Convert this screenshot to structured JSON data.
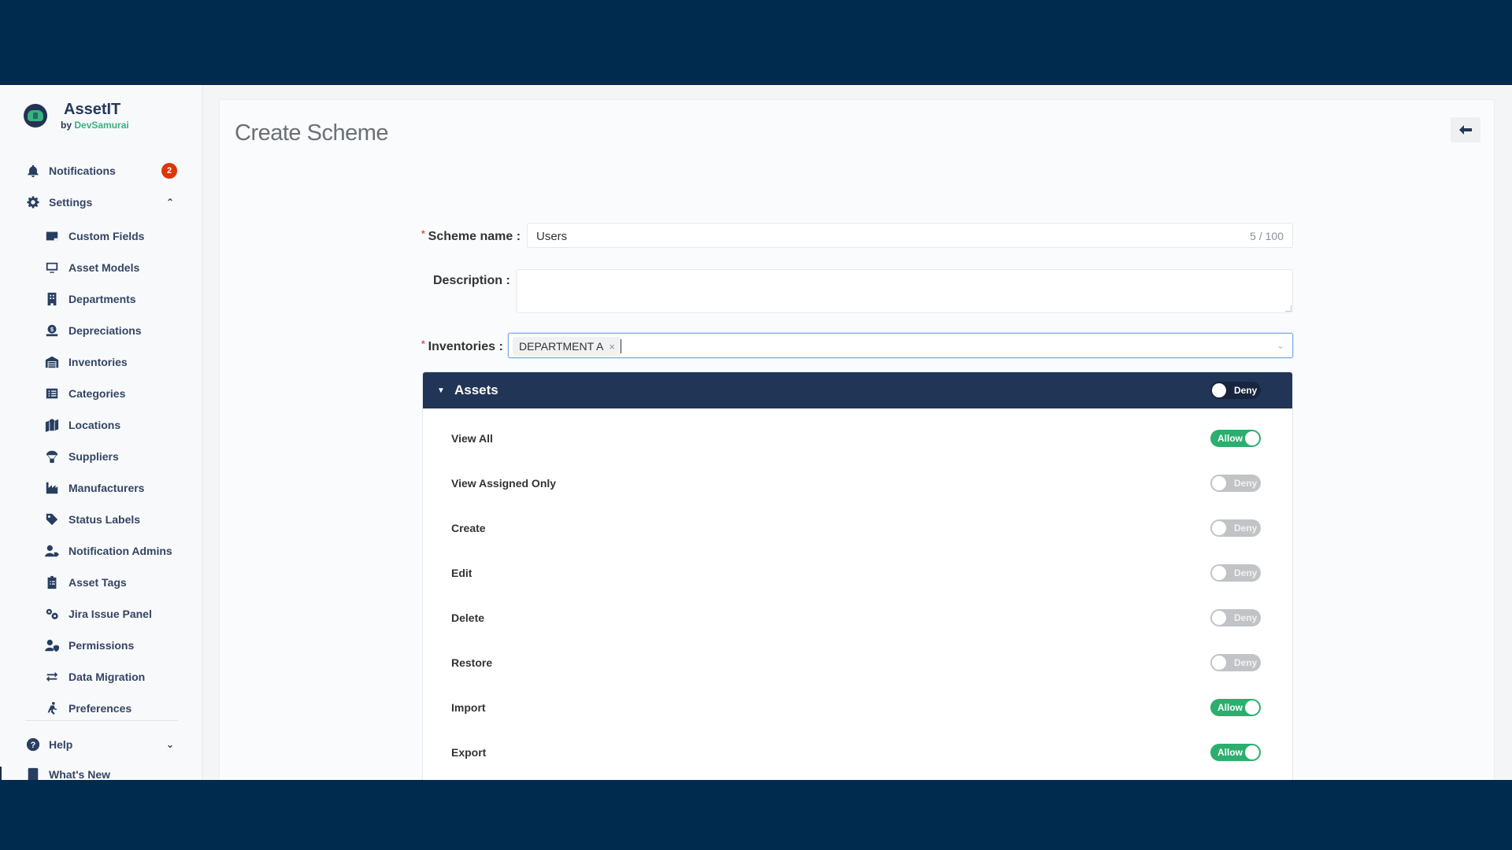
{
  "app": {
    "name": "AssetIT",
    "by_prefix": "by",
    "by_brand": "DevSamurai"
  },
  "sidebar": {
    "notifications": {
      "label": "Notifications",
      "count": "2"
    },
    "settings": {
      "label": "Settings",
      "expanded": true
    },
    "settings_items": [
      {
        "label": "Custom Fields",
        "icon": "custom-fields-icon"
      },
      {
        "label": "Asset Models",
        "icon": "monitor-icon"
      },
      {
        "label": "Departments",
        "icon": "building-icon"
      },
      {
        "label": "Depreciations",
        "icon": "money-hand-icon"
      },
      {
        "label": "Inventories",
        "icon": "warehouse-icon"
      },
      {
        "label": "Categories",
        "icon": "list-icon"
      },
      {
        "label": "Locations",
        "icon": "map-pin-icon"
      },
      {
        "label": "Suppliers",
        "icon": "parachute-box-icon"
      },
      {
        "label": "Manufacturers",
        "icon": "industry-icon"
      },
      {
        "label": "Status Labels",
        "icon": "tag-icon"
      },
      {
        "label": "Notification Admins",
        "icon": "user-tag-icon"
      },
      {
        "label": "Asset Tags",
        "icon": "clipboard-list-icon"
      },
      {
        "label": "Jira Issue Panel",
        "icon": "cogs-icon"
      },
      {
        "label": "Permissions",
        "icon": "user-shield-icon"
      },
      {
        "label": "Data Migration",
        "icon": "exchange-icon"
      },
      {
        "label": "Preferences",
        "icon": "running-icon"
      }
    ],
    "help": {
      "label": "Help"
    },
    "whats_new": {
      "label": "What's New"
    }
  },
  "page": {
    "title": "Create Scheme",
    "back_label": "Back"
  },
  "form": {
    "scheme_name": {
      "label": "Scheme name",
      "value": "Users",
      "counter": "5 / 100",
      "required": true
    },
    "description": {
      "label": "Description",
      "value": ""
    },
    "inventories": {
      "label": "Inventories",
      "required": true,
      "selected": [
        "DEPARTMENT A"
      ]
    }
  },
  "assets_panel": {
    "title": "Assets",
    "master_toggle": {
      "state": "off",
      "label": "Deny"
    },
    "permissions": [
      {
        "label": "View All",
        "state": "on",
        "toggle_label": "Allow"
      },
      {
        "label": "View Assigned Only",
        "state": "off",
        "toggle_label": "Deny"
      },
      {
        "label": "Create",
        "state": "off",
        "toggle_label": "Deny"
      },
      {
        "label": "Edit",
        "state": "off",
        "toggle_label": "Deny"
      },
      {
        "label": "Delete",
        "state": "off",
        "toggle_label": "Deny"
      },
      {
        "label": "Restore",
        "state": "off",
        "toggle_label": "Deny"
      },
      {
        "label": "Import",
        "state": "on",
        "toggle_label": "Allow"
      },
      {
        "label": "Export",
        "state": "on",
        "toggle_label": "Allow"
      }
    ]
  },
  "colors": {
    "backdrop": "#012a4f",
    "panel_header": "#213557",
    "allow": "#2cae6e",
    "deny": "#c1c3c6",
    "badge": "#de350b",
    "brand_green": "#36b37e"
  }
}
